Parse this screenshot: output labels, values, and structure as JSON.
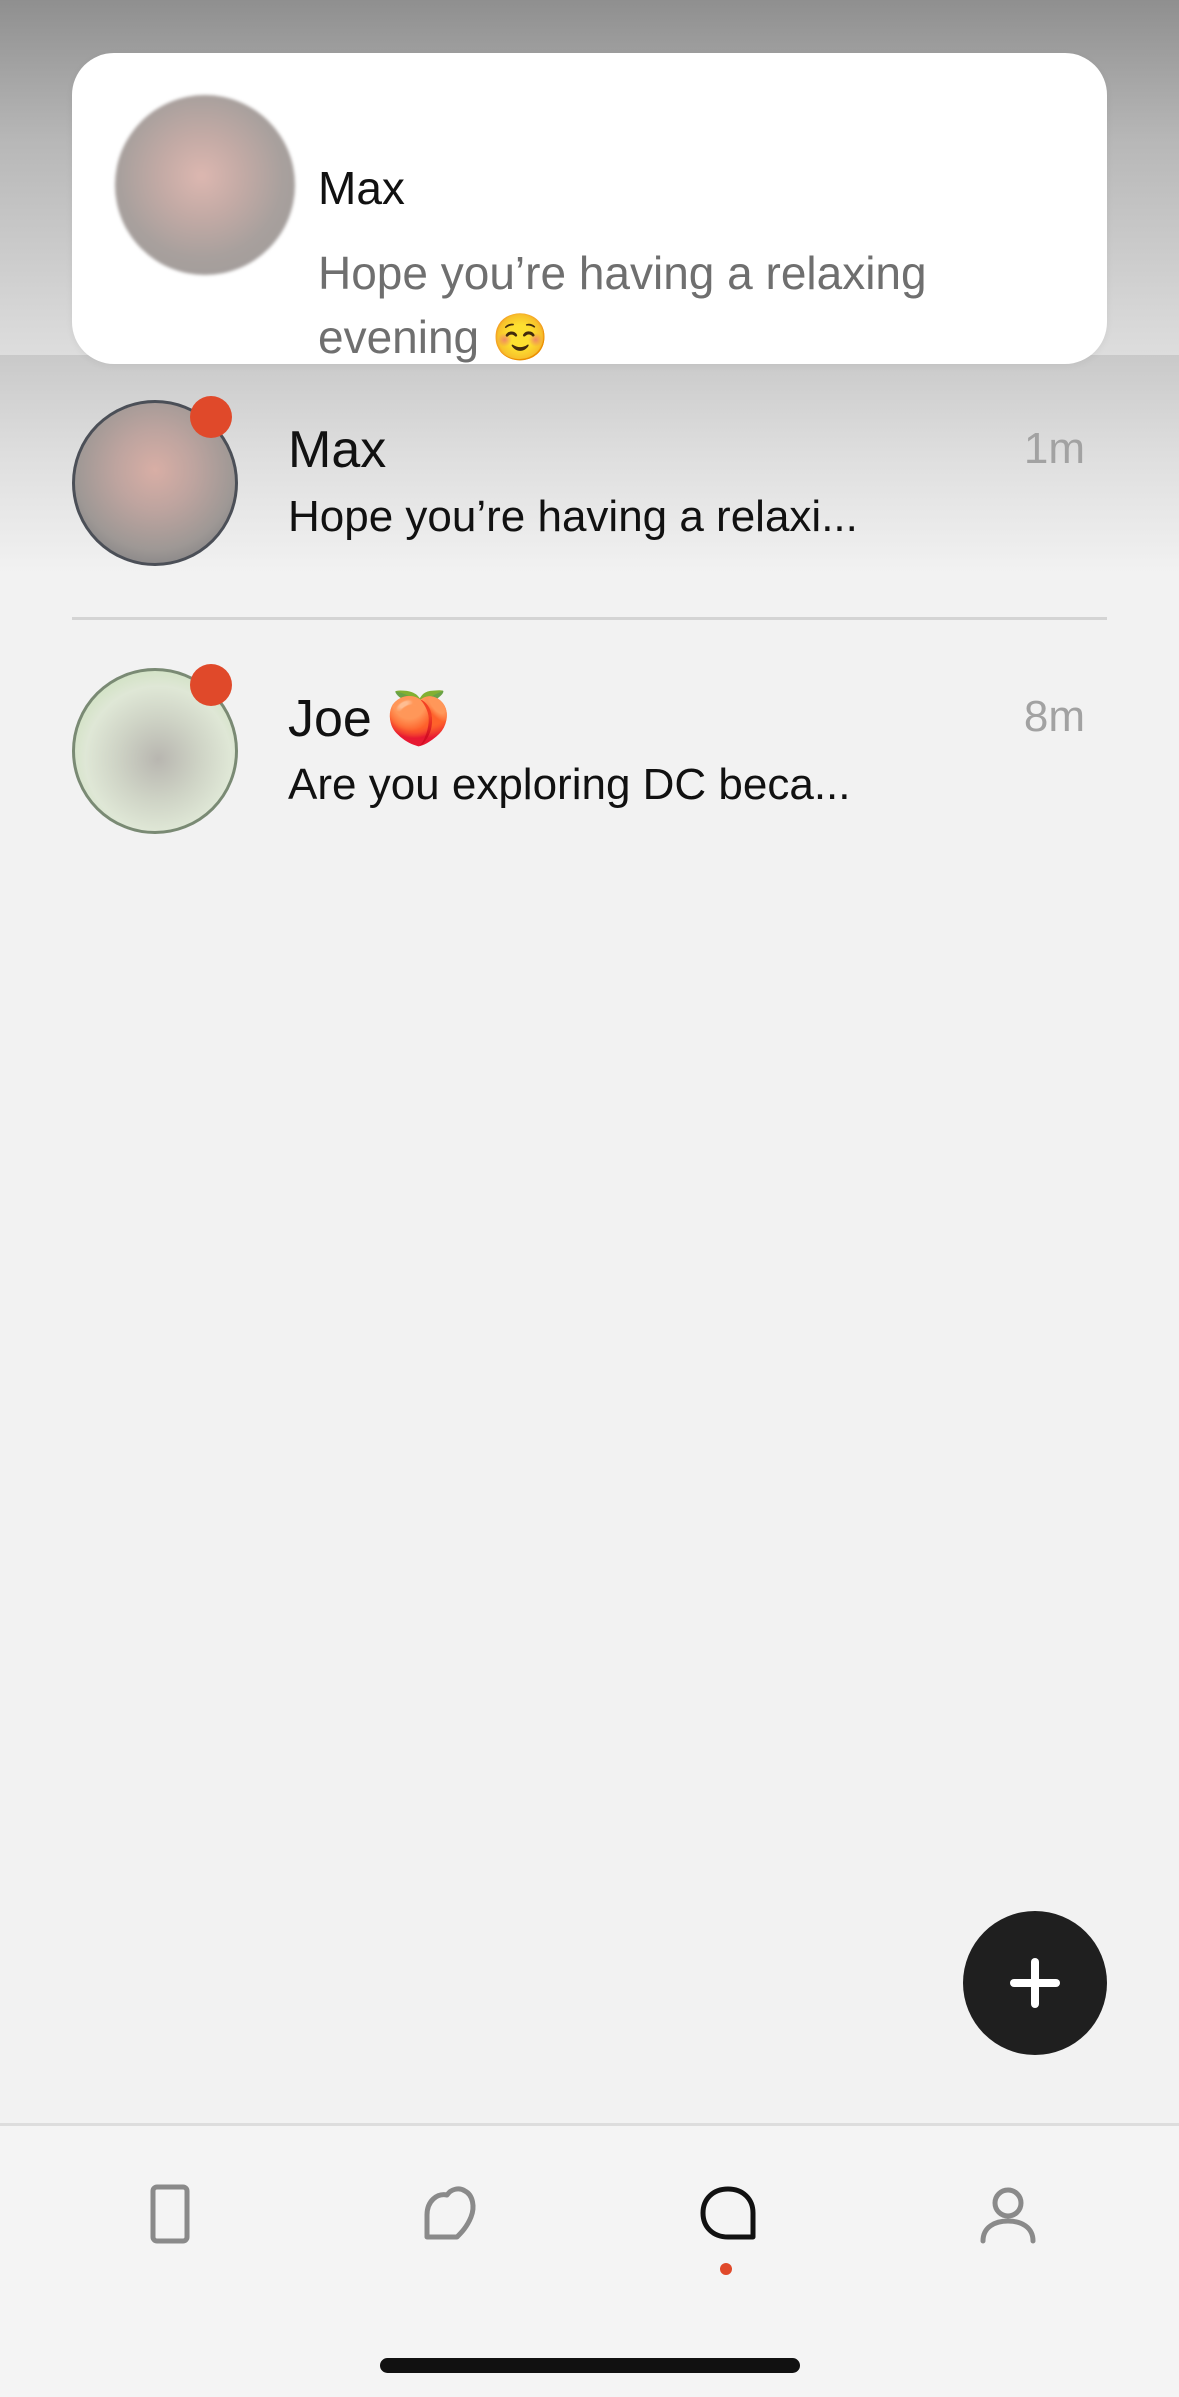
{
  "notification": {
    "sender": "Max",
    "message": "Hope you’re having a relaxing evening ☺️"
  },
  "conversations": [
    {
      "name": "Max",
      "time": "1m",
      "preview": "Hope you’re having a relaxi...",
      "unread": true
    },
    {
      "name": "Joe 🍑",
      "time": "8m",
      "preview": "Are you exploring DC beca...",
      "unread": true
    }
  ],
  "fab": {
    "icon": "plus-icon"
  },
  "tabbar": {
    "tabs": [
      {
        "icon": "card-icon",
        "active": false
      },
      {
        "icon": "heart-icon",
        "active": false
      },
      {
        "icon": "chat-bubble-icon",
        "active": true
      },
      {
        "icon": "profile-icon",
        "active": false
      }
    ]
  },
  "colors": {
    "accent": "#e0492a",
    "fab": "#1f1f1f",
    "background": "#f2f2f2"
  }
}
